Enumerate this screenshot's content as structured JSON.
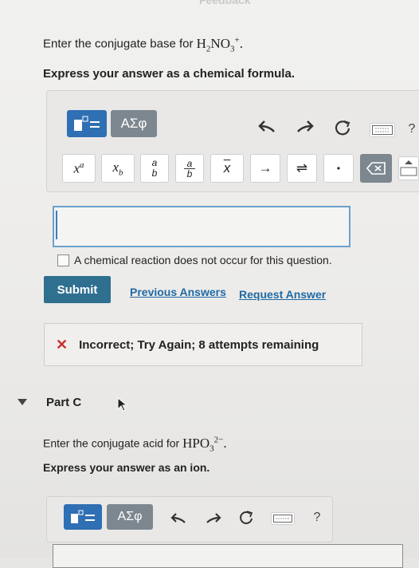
{
  "header": {
    "cut_title": "Feedback"
  },
  "partB": {
    "prompt_prefix": "Enter the conjugate base for ",
    "formula_main": "H",
    "formula_sub1": "2",
    "formula_mid": "NO",
    "formula_sub2": "3",
    "formula_sup": "+",
    "formula_end": ".",
    "instruction": "Express your answer as a chemical formula."
  },
  "toolbar": {
    "greek_label": "ΑΣφ",
    "help_label": "?",
    "buttons": [
      "superscript",
      "subscript",
      "fraction-small",
      "fraction",
      "bar",
      "arrow",
      "equilibrium",
      "dot",
      "delete",
      "keyboard"
    ]
  },
  "math_buttons": {
    "superscript": "x",
    "superscript_sup": "a",
    "subscript": "x",
    "subscript_sub": "b",
    "frac_num": "a",
    "frac_den": "b",
    "frac2_num": "a",
    "frac2_den": "b",
    "bar": "x",
    "arrow": "→",
    "equilibrium": "⇌",
    "dot": "•"
  },
  "checkbox_label": "A chemical reaction does not occur for this question.",
  "actions": {
    "submit": "Submit",
    "previous_answers": "Previous Answers",
    "request_answer": "Request Answer"
  },
  "feedback": {
    "text": "Incorrect; Try Again; 8 attempts remaining"
  },
  "partC": {
    "title": "Part C",
    "prompt_prefix": "Enter the conjugate acid for ",
    "formula_main": "HPO",
    "formula_sub": "3",
    "formula_sup": "2−",
    "formula_end": ".",
    "instruction": "Express your answer as an ion."
  },
  "colors": {
    "accent": "#2f6fb3",
    "submit": "#2f6f90",
    "link": "#1f6aa5",
    "error": "#c9302c"
  }
}
